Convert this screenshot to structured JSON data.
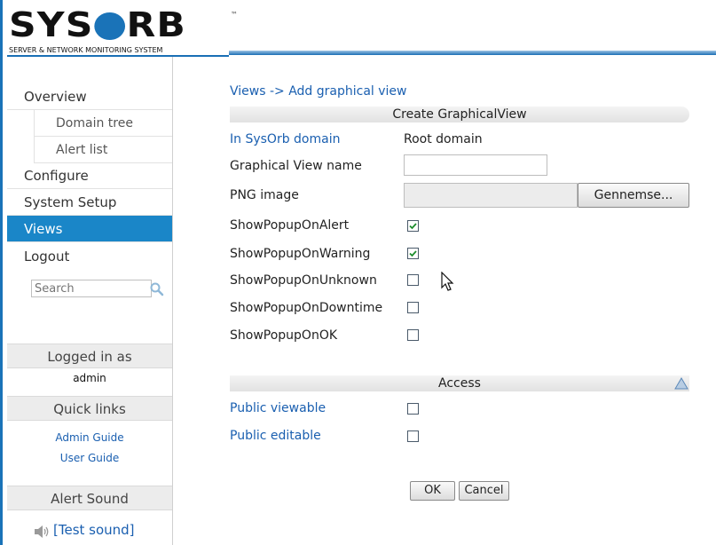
{
  "header": {
    "logo_text": "SYSORB",
    "logo_tm": "™",
    "tagline": "SERVER & NETWORK MONITORING SYSTEM",
    "accent": "#1a73b8"
  },
  "sidebar": {
    "items": [
      {
        "label": "Overview"
      },
      {
        "label": "Domain tree"
      },
      {
        "label": "Alert list"
      },
      {
        "label": "Configure"
      },
      {
        "label": "System Setup"
      },
      {
        "label": "Views",
        "active": true
      },
      {
        "label": "Logout"
      }
    ],
    "search_placeholder": "Search",
    "logged_in_header": "Logged in as",
    "logged_in_user": "admin",
    "quick_links_header": "Quick links",
    "quick_links": [
      "Admin Guide",
      "User Guide"
    ],
    "alert_sound_header": "Alert Sound",
    "test_sound_label": "[Test sound]",
    "active_color": "#1a86c8"
  },
  "main": {
    "breadcrumb": "Views -> Add graphical view",
    "section_title": "Create GraphicalView",
    "domain_label": "In SysOrb domain",
    "domain_value": "Root domain",
    "name_label": "Graphical View name",
    "name_value": "",
    "png_label": "PNG image",
    "browse_label": "Gennemse...",
    "options": [
      {
        "label": "ShowPopupOnAlert",
        "checked": true
      },
      {
        "label": "ShowPopupOnWarning",
        "checked": true
      },
      {
        "label": "ShowPopupOnUnknown",
        "checked": false
      },
      {
        "label": "ShowPopupOnDowntime",
        "checked": false
      },
      {
        "label": "ShowPopupOnOK",
        "checked": false
      }
    ],
    "access_title": "Access",
    "access": [
      {
        "label": "Public viewable",
        "checked": false
      },
      {
        "label": "Public editable",
        "checked": false
      }
    ],
    "ok_label": "OK",
    "cancel_label": "Cancel",
    "link_color": "#1a5fb0"
  }
}
